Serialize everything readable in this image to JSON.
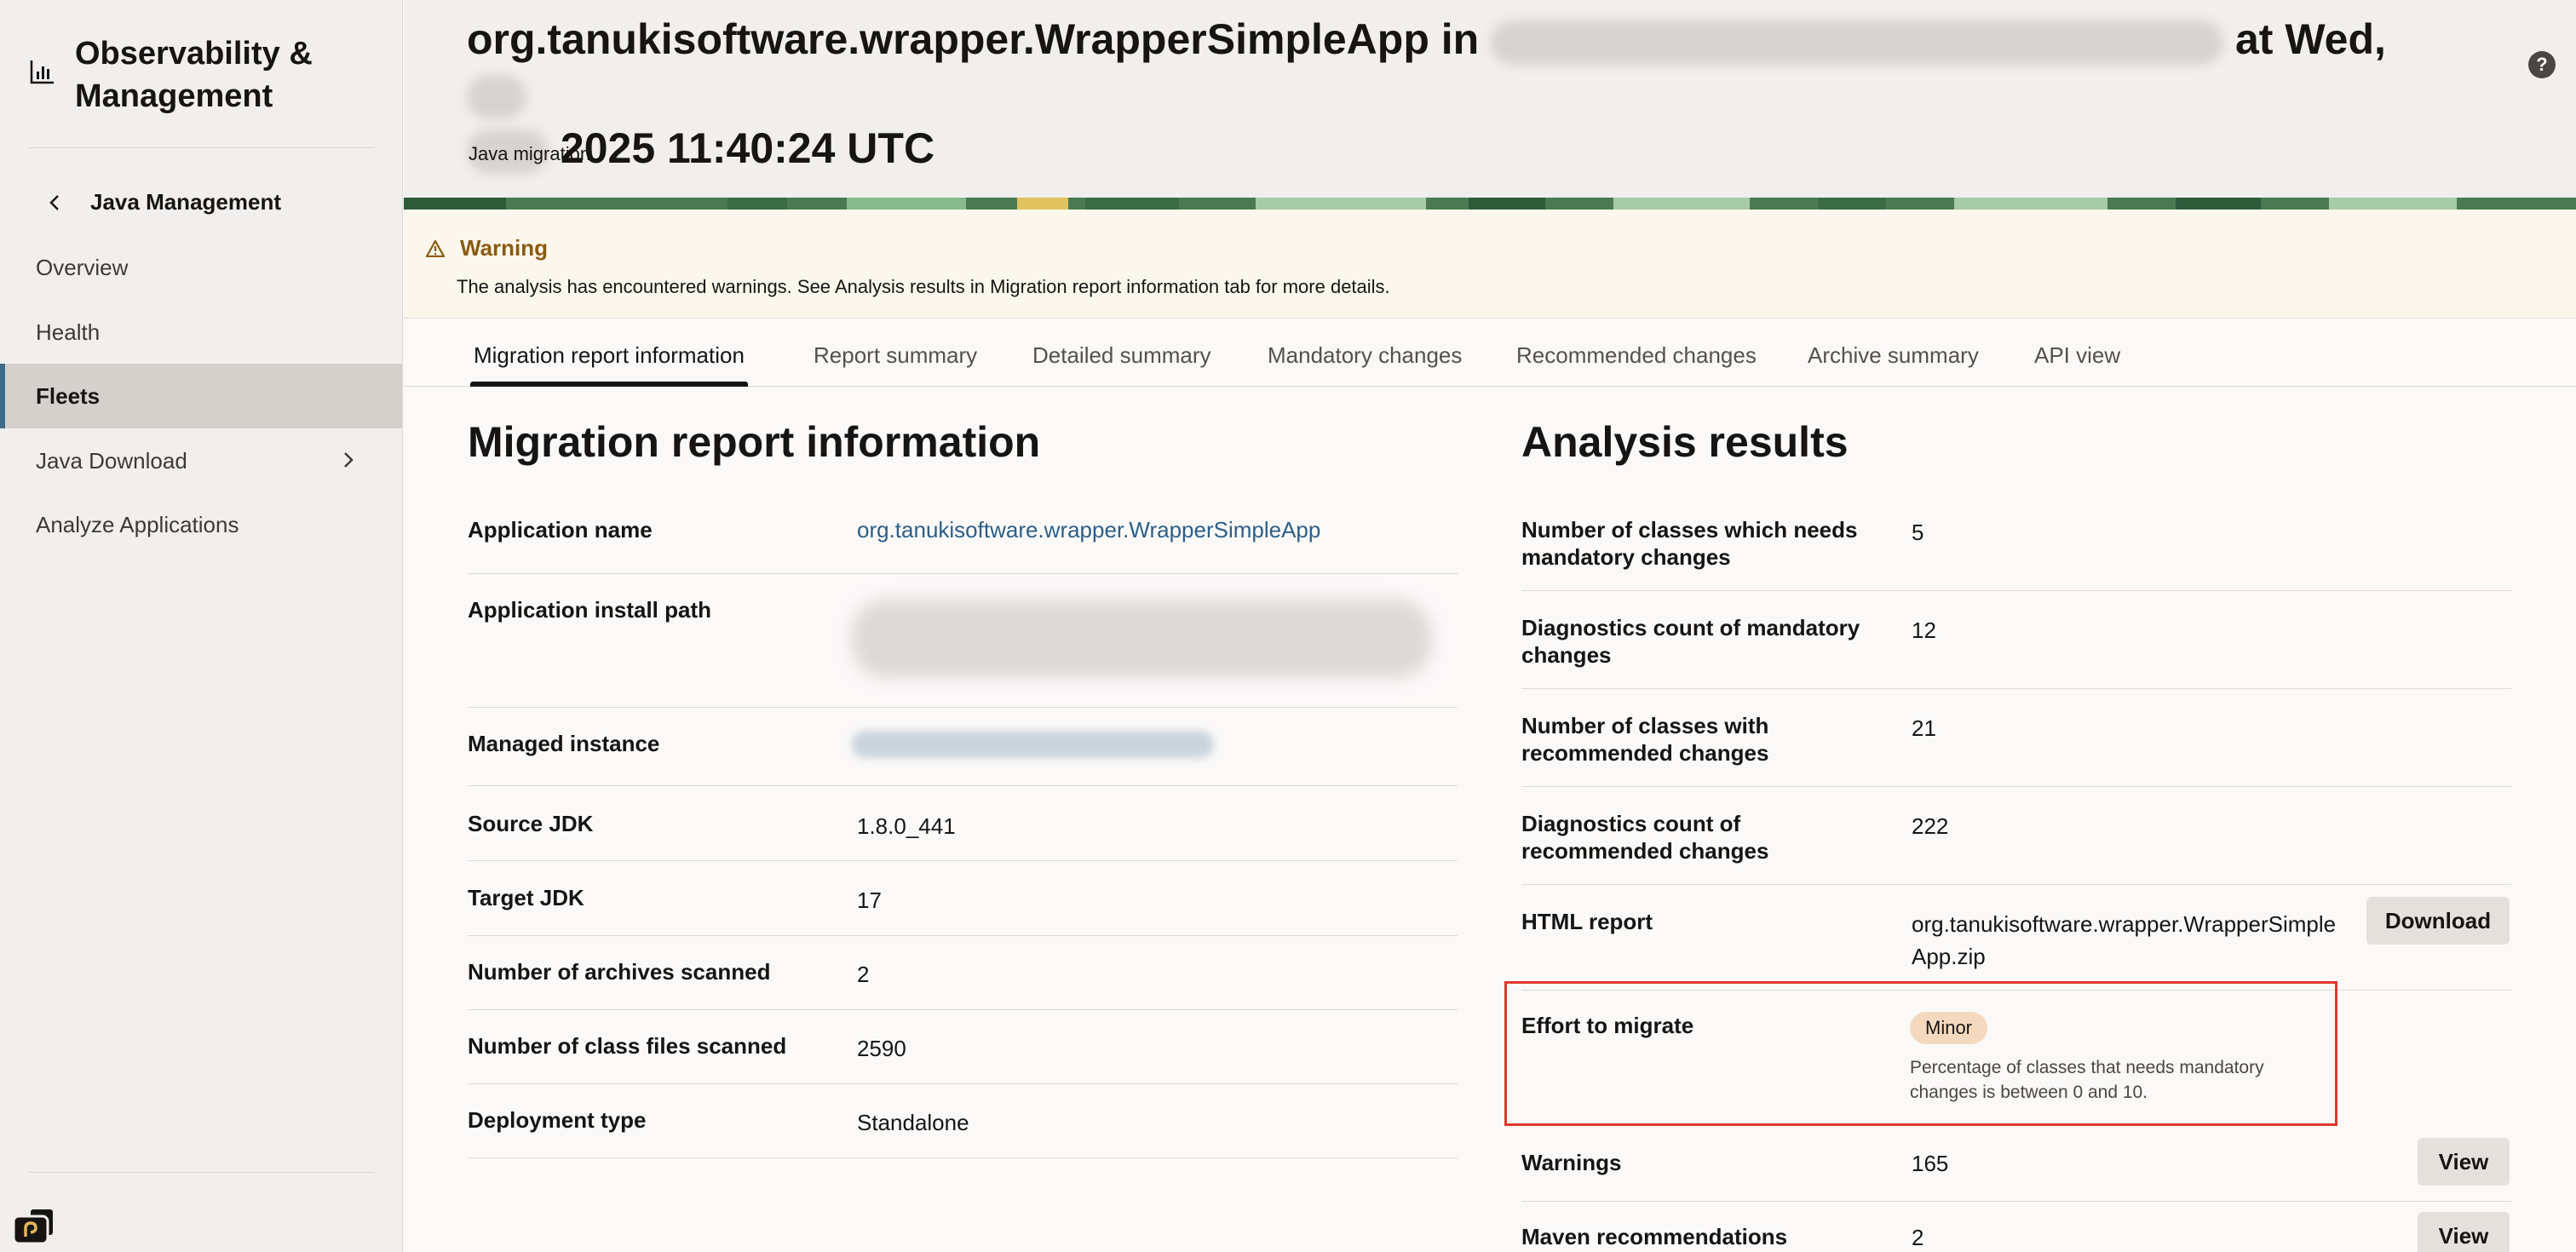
{
  "sidebar": {
    "brand": "Observability & Management",
    "back_label": "Java Management",
    "items": [
      {
        "label": "Overview"
      },
      {
        "label": "Health"
      },
      {
        "label": "Fleets"
      },
      {
        "label": "Java Download"
      },
      {
        "label": "Analyze Applications"
      }
    ]
  },
  "header": {
    "title_part1": "org.tanukisoftware.wrapper.WrapperSimpleApp in",
    "title_part2": "at Wed,",
    "title_part3": "2025 11:40:24 UTC",
    "subtitle": "Java migration"
  },
  "warning": {
    "title": "Warning",
    "text": "The analysis has encountered warnings. See Analysis results in Migration report information tab for more details."
  },
  "tabs": [
    {
      "label": "Migration report information"
    },
    {
      "label": "Report summary"
    },
    {
      "label": "Detailed summary"
    },
    {
      "label": "Mandatory changes"
    },
    {
      "label": "Recommended changes"
    },
    {
      "label": "Archive summary"
    },
    {
      "label": "API view"
    }
  ],
  "migration_info": {
    "title": "Migration report information",
    "rows": [
      {
        "label": "Application name",
        "value": "org.tanukisoftware.wrapper.WrapperSimpleApp"
      },
      {
        "label": "Application install path",
        "value": ""
      },
      {
        "label": "Managed instance",
        "value": ""
      },
      {
        "label": "Source JDK",
        "value": "1.8.0_441"
      },
      {
        "label": "Target JDK",
        "value": "17"
      },
      {
        "label": "Number of archives scanned",
        "value": "2"
      },
      {
        "label": "Number of class files scanned",
        "value": "2590"
      },
      {
        "label": "Deployment type",
        "value": "Standalone"
      }
    ]
  },
  "analysis": {
    "title": "Analysis results",
    "rows": [
      {
        "label": "Number of classes which needs mandatory changes",
        "value": "5"
      },
      {
        "label": "Diagnostics count of mandatory changes",
        "value": "12"
      },
      {
        "label": "Number of classes with recommended changes",
        "value": "21"
      },
      {
        "label": "Diagnostics count of recommended changes",
        "value": "222"
      },
      {
        "label": "HTML report",
        "value": "org.tanukisoftware.wrapper.WrapperSimpleApp.zip",
        "button": "Download"
      },
      {
        "label": "Effort to migrate",
        "value": "Minor",
        "hint": "Percentage of classes that needs mandatory changes is between 0 and 10."
      },
      {
        "label": "Warnings",
        "value": "165",
        "button": "View"
      },
      {
        "label": "Maven recommendations",
        "value": "2",
        "button": "View"
      }
    ]
  },
  "colors": {
    "accent": "#3f6b8a",
    "link": "#2b5f87",
    "warning": "#8a5a12",
    "highlight": "#e0372a",
    "badge": "#f4d9be"
  }
}
